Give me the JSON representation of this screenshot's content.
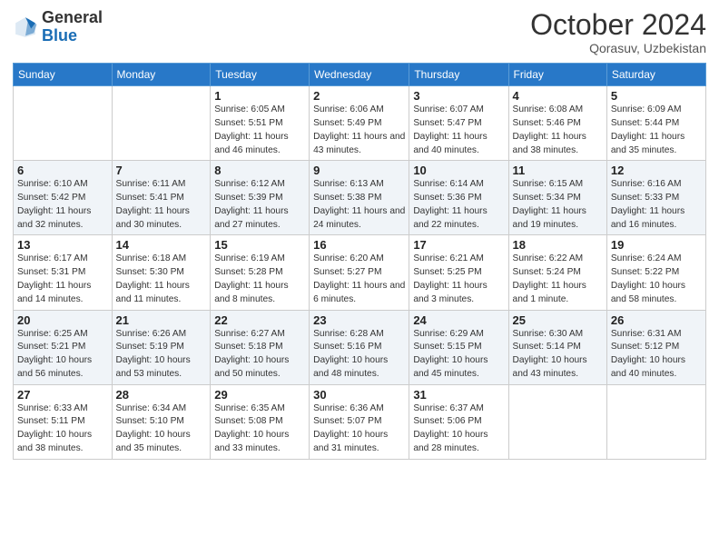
{
  "header": {
    "logo_general": "General",
    "logo_blue": "Blue",
    "month_title": "October 2024",
    "subtitle": "Qorasuv, Uzbekistan"
  },
  "weekdays": [
    "Sunday",
    "Monday",
    "Tuesday",
    "Wednesday",
    "Thursday",
    "Friday",
    "Saturday"
  ],
  "weeks": [
    {
      "days": [
        {
          "num": "",
          "sunrise": "",
          "sunset": "",
          "daylight": ""
        },
        {
          "num": "",
          "sunrise": "",
          "sunset": "",
          "daylight": ""
        },
        {
          "num": "1",
          "sunrise": "Sunrise: 6:05 AM",
          "sunset": "Sunset: 5:51 PM",
          "daylight": "Daylight: 11 hours and 46 minutes."
        },
        {
          "num": "2",
          "sunrise": "Sunrise: 6:06 AM",
          "sunset": "Sunset: 5:49 PM",
          "daylight": "Daylight: 11 hours and 43 minutes."
        },
        {
          "num": "3",
          "sunrise": "Sunrise: 6:07 AM",
          "sunset": "Sunset: 5:47 PM",
          "daylight": "Daylight: 11 hours and 40 minutes."
        },
        {
          "num": "4",
          "sunrise": "Sunrise: 6:08 AM",
          "sunset": "Sunset: 5:46 PM",
          "daylight": "Daylight: 11 hours and 38 minutes."
        },
        {
          "num": "5",
          "sunrise": "Sunrise: 6:09 AM",
          "sunset": "Sunset: 5:44 PM",
          "daylight": "Daylight: 11 hours and 35 minutes."
        }
      ]
    },
    {
      "days": [
        {
          "num": "6",
          "sunrise": "Sunrise: 6:10 AM",
          "sunset": "Sunset: 5:42 PM",
          "daylight": "Daylight: 11 hours and 32 minutes."
        },
        {
          "num": "7",
          "sunrise": "Sunrise: 6:11 AM",
          "sunset": "Sunset: 5:41 PM",
          "daylight": "Daylight: 11 hours and 30 minutes."
        },
        {
          "num": "8",
          "sunrise": "Sunrise: 6:12 AM",
          "sunset": "Sunset: 5:39 PM",
          "daylight": "Daylight: 11 hours and 27 minutes."
        },
        {
          "num": "9",
          "sunrise": "Sunrise: 6:13 AM",
          "sunset": "Sunset: 5:38 PM",
          "daylight": "Daylight: 11 hours and 24 minutes."
        },
        {
          "num": "10",
          "sunrise": "Sunrise: 6:14 AM",
          "sunset": "Sunset: 5:36 PM",
          "daylight": "Daylight: 11 hours and 22 minutes."
        },
        {
          "num": "11",
          "sunrise": "Sunrise: 6:15 AM",
          "sunset": "Sunset: 5:34 PM",
          "daylight": "Daylight: 11 hours and 19 minutes."
        },
        {
          "num": "12",
          "sunrise": "Sunrise: 6:16 AM",
          "sunset": "Sunset: 5:33 PM",
          "daylight": "Daylight: 11 hours and 16 minutes."
        }
      ]
    },
    {
      "days": [
        {
          "num": "13",
          "sunrise": "Sunrise: 6:17 AM",
          "sunset": "Sunset: 5:31 PM",
          "daylight": "Daylight: 11 hours and 14 minutes."
        },
        {
          "num": "14",
          "sunrise": "Sunrise: 6:18 AM",
          "sunset": "Sunset: 5:30 PM",
          "daylight": "Daylight: 11 hours and 11 minutes."
        },
        {
          "num": "15",
          "sunrise": "Sunrise: 6:19 AM",
          "sunset": "Sunset: 5:28 PM",
          "daylight": "Daylight: 11 hours and 8 minutes."
        },
        {
          "num": "16",
          "sunrise": "Sunrise: 6:20 AM",
          "sunset": "Sunset: 5:27 PM",
          "daylight": "Daylight: 11 hours and 6 minutes."
        },
        {
          "num": "17",
          "sunrise": "Sunrise: 6:21 AM",
          "sunset": "Sunset: 5:25 PM",
          "daylight": "Daylight: 11 hours and 3 minutes."
        },
        {
          "num": "18",
          "sunrise": "Sunrise: 6:22 AM",
          "sunset": "Sunset: 5:24 PM",
          "daylight": "Daylight: 11 hours and 1 minute."
        },
        {
          "num": "19",
          "sunrise": "Sunrise: 6:24 AM",
          "sunset": "Sunset: 5:22 PM",
          "daylight": "Daylight: 10 hours and 58 minutes."
        }
      ]
    },
    {
      "days": [
        {
          "num": "20",
          "sunrise": "Sunrise: 6:25 AM",
          "sunset": "Sunset: 5:21 PM",
          "daylight": "Daylight: 10 hours and 56 minutes."
        },
        {
          "num": "21",
          "sunrise": "Sunrise: 6:26 AM",
          "sunset": "Sunset: 5:19 PM",
          "daylight": "Daylight: 10 hours and 53 minutes."
        },
        {
          "num": "22",
          "sunrise": "Sunrise: 6:27 AM",
          "sunset": "Sunset: 5:18 PM",
          "daylight": "Daylight: 10 hours and 50 minutes."
        },
        {
          "num": "23",
          "sunrise": "Sunrise: 6:28 AM",
          "sunset": "Sunset: 5:16 PM",
          "daylight": "Daylight: 10 hours and 48 minutes."
        },
        {
          "num": "24",
          "sunrise": "Sunrise: 6:29 AM",
          "sunset": "Sunset: 5:15 PM",
          "daylight": "Daylight: 10 hours and 45 minutes."
        },
        {
          "num": "25",
          "sunrise": "Sunrise: 6:30 AM",
          "sunset": "Sunset: 5:14 PM",
          "daylight": "Daylight: 10 hours and 43 minutes."
        },
        {
          "num": "26",
          "sunrise": "Sunrise: 6:31 AM",
          "sunset": "Sunset: 5:12 PM",
          "daylight": "Daylight: 10 hours and 40 minutes."
        }
      ]
    },
    {
      "days": [
        {
          "num": "27",
          "sunrise": "Sunrise: 6:33 AM",
          "sunset": "Sunset: 5:11 PM",
          "daylight": "Daylight: 10 hours and 38 minutes."
        },
        {
          "num": "28",
          "sunrise": "Sunrise: 6:34 AM",
          "sunset": "Sunset: 5:10 PM",
          "daylight": "Daylight: 10 hours and 35 minutes."
        },
        {
          "num": "29",
          "sunrise": "Sunrise: 6:35 AM",
          "sunset": "Sunset: 5:08 PM",
          "daylight": "Daylight: 10 hours and 33 minutes."
        },
        {
          "num": "30",
          "sunrise": "Sunrise: 6:36 AM",
          "sunset": "Sunset: 5:07 PM",
          "daylight": "Daylight: 10 hours and 31 minutes."
        },
        {
          "num": "31",
          "sunrise": "Sunrise: 6:37 AM",
          "sunset": "Sunset: 5:06 PM",
          "daylight": "Daylight: 10 hours and 28 minutes."
        },
        {
          "num": "",
          "sunrise": "",
          "sunset": "",
          "daylight": ""
        },
        {
          "num": "",
          "sunrise": "",
          "sunset": "",
          "daylight": ""
        }
      ]
    }
  ]
}
